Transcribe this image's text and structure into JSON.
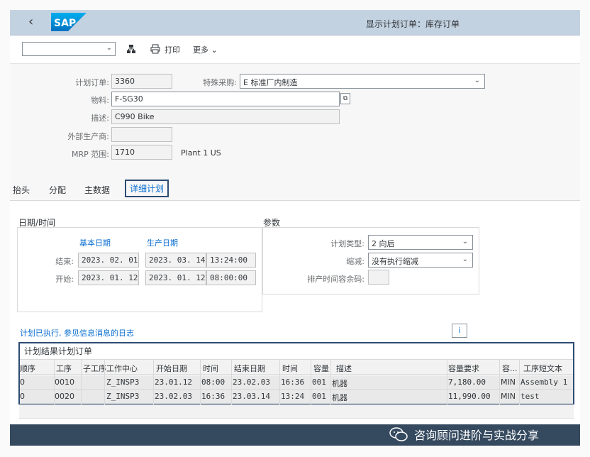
{
  "shell": {
    "back_glyph": "‹",
    "logo_text": "SAP",
    "title": "显示计划订单：库存订单"
  },
  "toolbar": {
    "variant_value": "",
    "print_label": "打印",
    "more_label": "更多"
  },
  "header": {
    "plan_order_label": "计划订单:",
    "plan_order_value": "3360",
    "special_proc_label": "特殊采购:",
    "special_proc_value": "E 标准厂内制造",
    "material_label": "物料:",
    "material_value": "F-SG30",
    "desc_label": "描述:",
    "desc_value": "C990 Bike",
    "ext_mfr_label": "外部生产商:",
    "ext_mfr_value": "",
    "mrp_label": "MRP 范围:",
    "mrp_value": "1710",
    "mrp_text": "Plant 1 US"
  },
  "tabs": [
    {
      "label": "抬头"
    },
    {
      "label": "分配"
    },
    {
      "label": "主数据"
    },
    {
      "label": "详细计划",
      "active": true
    }
  ],
  "dates": {
    "section_title": "日期/时间",
    "basic_header": "基本日期",
    "prod_header": "生产日期",
    "end_label": "结束:",
    "end_basic": "2023. 02. 01",
    "end_prod": "2023. 03. 14",
    "end_time": "13:24:00",
    "start_label": "开始:",
    "start_basic": "2023. 01. 12",
    "start_prod": "2023. 01. 12",
    "start_time": "08:00:00"
  },
  "params": {
    "section_title": "参数",
    "sched_type_label": "计划类型:",
    "sched_type_value": "2 向后",
    "reduction_label": "缩减:",
    "reduction_value": "没有执行缩减",
    "float_label": "排产时间容余码:",
    "float_value": ""
  },
  "log_link": "计划已执行, 参见信息消息的日志",
  "info_icon": "i",
  "ops": {
    "title": "计划结果计划订单",
    "columns": [
      "顺序",
      "工序",
      "子工序",
      "工作中心",
      "开始日期",
      "时间",
      "结束日期",
      "时间",
      "容量",
      "描述",
      "容量要求",
      "容...",
      "工序短文本"
    ],
    "rows": [
      [
        "0",
        "0010",
        "",
        "Z_INSP3",
        "23.01.12",
        "08:00",
        "23.02.03",
        "16:36",
        "001",
        "机器",
        "7,180.00",
        "MIN",
        "Assembly 1"
      ],
      [
        "0",
        "0020",
        "",
        "Z_INSP3",
        "23.02.03",
        "16:36",
        "23.03.14",
        "13:24",
        "001",
        "机器",
        "11,990.00",
        "MIN",
        "test"
      ]
    ]
  },
  "watermark": "咨询顾问进阶与实战分享",
  "colors": {
    "shell": "#c3d2e1",
    "accent": "#0a6ed1",
    "highlight_border": "#2d4c73",
    "footer": "#354a5f"
  }
}
